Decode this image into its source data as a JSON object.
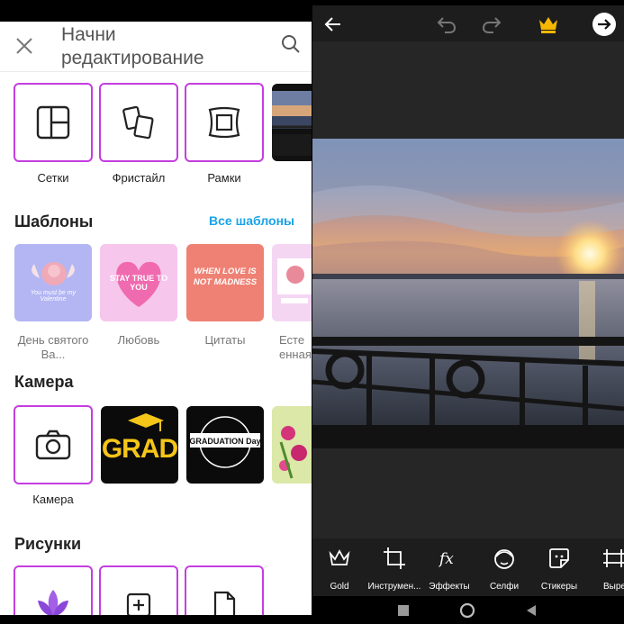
{
  "left": {
    "header": {
      "title": "Начни редактирование"
    },
    "tools": [
      {
        "label": "Сетки",
        "icon": "grid-icon"
      },
      {
        "label": "Фристайл",
        "icon": "freestyle-icon"
      },
      {
        "label": "Рамки",
        "icon": "frame-icon"
      }
    ],
    "templates": {
      "title": "Шаблоны",
      "all_link": "Все шаблоны",
      "items": [
        {
          "label": "День святого Ва...",
          "art_text": "You must be my Valentine"
        },
        {
          "label": "Любовь",
          "art_text": "STAY TRUE TO YOU"
        },
        {
          "label": "Цитаты",
          "art_text": "WHEN LOVE IS NOT MADNESS"
        },
        {
          "label": "Есте енная"
        }
      ]
    },
    "camera": {
      "title": "Камера",
      "items": [
        {
          "label": "Камера",
          "icon": "camera-icon"
        },
        {
          "art_text": "GRAD"
        },
        {
          "art_text": "GRADUATION Day"
        },
        {
          "icon": "flowers-icon"
        }
      ]
    },
    "drawings": {
      "title": "Рисунки",
      "items": [
        {
          "icon": "lotus-icon"
        },
        {
          "icon": "add-canvas-icon"
        },
        {
          "icon": "blank-page-icon"
        }
      ]
    }
  },
  "right": {
    "toolbar": {
      "back": "arrow-left-icon",
      "undo": "undo-icon",
      "redo": "redo-icon",
      "premium": "crown-icon",
      "next": "arrow-right-circle-icon"
    },
    "tools": [
      {
        "label": "Gold",
        "icon": "crown-outline-icon"
      },
      {
        "label": "Инструмен...",
        "icon": "crop-icon"
      },
      {
        "label": "Эффекты",
        "icon": "fx-icon"
      },
      {
        "label": "Селфи",
        "icon": "selfie-icon"
      },
      {
        "label": "Стикеры",
        "icon": "sticker-icon"
      },
      {
        "label": "Выре",
        "icon": "cutout-icon"
      }
    ]
  },
  "colors": {
    "accent": "#c43ee0",
    "link": "#1aa3e8",
    "editor_bg": "#1d1d1d"
  }
}
